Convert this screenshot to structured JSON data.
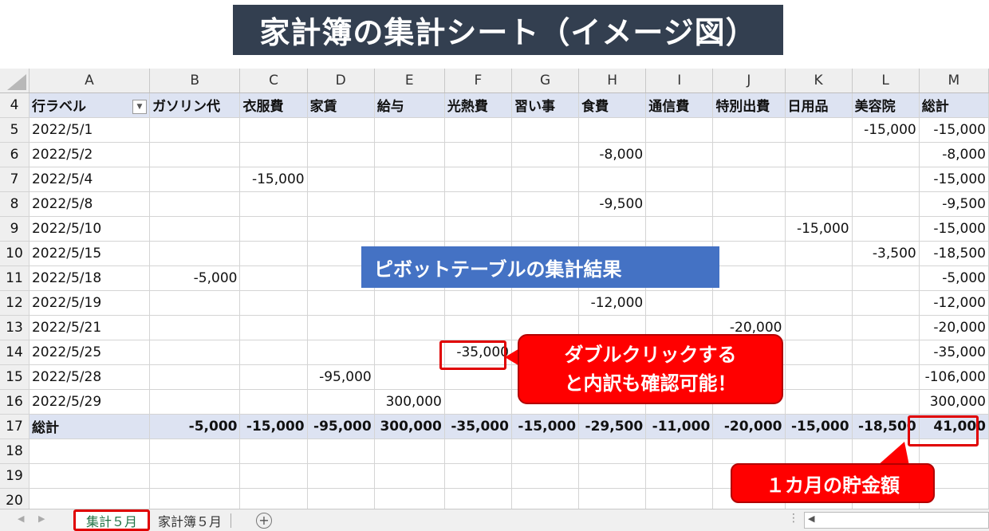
{
  "title": "家計簿の集計シート（イメージ図）",
  "columns": [
    "A",
    "B",
    "C",
    "D",
    "E",
    "F",
    "G",
    "H",
    "I",
    "J",
    "K",
    "L",
    "M"
  ],
  "header_row": {
    "row": "4",
    "cells": [
      "行ラベル",
      "ガソリン代",
      "衣服費",
      "家賃",
      "給与",
      "光熱費",
      "習い事",
      "食費",
      "通信費",
      "特別出費",
      "日用品",
      "美容院",
      "総計"
    ]
  },
  "rows": [
    {
      "row": "5",
      "cells": [
        "2022/5/1",
        "",
        "",
        "",
        "",
        "",
        "",
        "",
        "",
        "",
        "",
        "-15,000",
        "-15,000"
      ]
    },
    {
      "row": "6",
      "cells": [
        "2022/5/2",
        "",
        "",
        "",
        "",
        "",
        "",
        "-8,000",
        "",
        "",
        "",
        "",
        "-8,000"
      ]
    },
    {
      "row": "7",
      "cells": [
        "2022/5/4",
        "",
        "-15,000",
        "",
        "",
        "",
        "",
        "",
        "",
        "",
        "",
        "",
        "-15,000"
      ]
    },
    {
      "row": "8",
      "cells": [
        "2022/5/8",
        "",
        "",
        "",
        "",
        "",
        "",
        "-9,500",
        "",
        "",
        "",
        "",
        "-9,500"
      ]
    },
    {
      "row": "9",
      "cells": [
        "2022/5/10",
        "",
        "",
        "",
        "",
        "",
        "",
        "",
        "",
        "",
        "-15,000",
        "",
        "-15,000"
      ]
    },
    {
      "row": "10",
      "cells": [
        "2022/5/15",
        "",
        "",
        "",
        "",
        "",
        "",
        "",
        "",
        "",
        "",
        "-3,500",
        "-18,500"
      ]
    },
    {
      "row": "11",
      "cells": [
        "2022/5/18",
        "-5,000",
        "",
        "",
        "",
        "",
        "",
        "",
        "",
        "",
        "",
        "",
        "-5,000"
      ]
    },
    {
      "row": "12",
      "cells": [
        "2022/5/19",
        "",
        "",
        "",
        "",
        "",
        "",
        "-12,000",
        "",
        "",
        "",
        "",
        "-12,000"
      ]
    },
    {
      "row": "13",
      "cells": [
        "2022/5/21",
        "",
        "",
        "",
        "",
        "",
        "",
        "",
        "",
        "-20,000",
        "",
        "",
        "-20,000"
      ]
    },
    {
      "row": "14",
      "cells": [
        "2022/5/25",
        "",
        "",
        "",
        "",
        "-35,000",
        "",
        "",
        "",
        "",
        "",
        "",
        "-35,000"
      ]
    },
    {
      "row": "15",
      "cells": [
        "2022/5/28",
        "",
        "",
        "-95,000",
        "",
        "",
        "",
        "",
        "",
        "",
        "",
        "",
        "-106,000"
      ]
    },
    {
      "row": "16",
      "cells": [
        "2022/5/29",
        "",
        "",
        "",
        "300,000",
        "",
        "",
        "",
        "",
        "",
        "",
        "",
        "300,000"
      ]
    }
  ],
  "total_row": {
    "row": "17",
    "cells": [
      "総計",
      "-5,000",
      "-15,000",
      "-95,000",
      "300,000",
      "-35,000",
      "-15,000",
      "-29,500",
      "-11,000",
      "-20,000",
      "-15,000",
      "-18,500",
      "41,000"
    ]
  },
  "empty_rows": [
    "18",
    "19",
    "20"
  ],
  "annotations": {
    "pivot_label": "ピボットテーブルの集計結果",
    "double_click_line1": "ダブルクリックする",
    "double_click_line2": "と内訳も確認可能！",
    "savings_label": "１カ月の貯金額"
  },
  "sheet_tabs": {
    "active": "集計５月",
    "other": "家計簿５月"
  },
  "colors": {
    "title_bg": "#333f50",
    "pivot_header_bg": "#dde3f2",
    "pivot_label_bg": "#4472c4",
    "callout_red": "#ff0000",
    "active_tab_text": "#217346"
  },
  "icons": [
    "filter-dropdown-icon",
    "add-sheet-icon",
    "scroll-left-icon"
  ]
}
